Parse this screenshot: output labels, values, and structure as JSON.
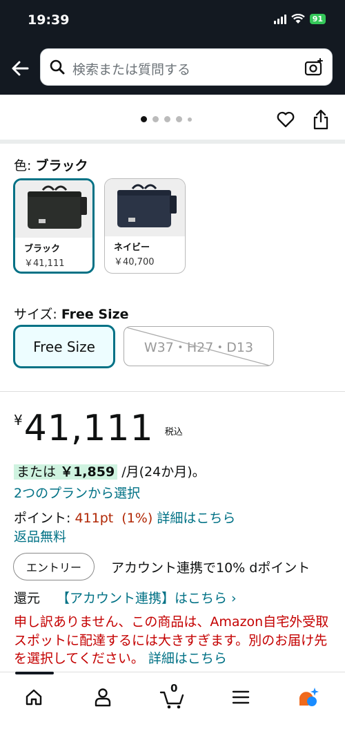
{
  "status": {
    "time": "19:39",
    "battery": "91"
  },
  "search": {
    "placeholder": "検索または質問する"
  },
  "carousel": {
    "dots": 5,
    "active": 0
  },
  "color": {
    "label": "色: ",
    "selected": "ブラック",
    "options": [
      {
        "name": "ブラック",
        "price": "￥41,111",
        "selected": true
      },
      {
        "name": "ネイビー",
        "price": "￥40,700",
        "selected": false
      }
    ]
  },
  "size": {
    "label": "サイズ: ",
    "selected": "Free Size",
    "options": [
      {
        "name": "Free Size",
        "selected": true,
        "available": true
      },
      {
        "name": "W37・H27・D13",
        "selected": false,
        "available": false
      }
    ]
  },
  "price": {
    "currency": "¥",
    "amount": "41,111",
    "tax": "税込"
  },
  "installment": {
    "prefix": "または",
    "amount": "￥1,859",
    "suffix": " /月(24か月)。",
    "plans_link": "2つのプランから選択"
  },
  "points": {
    "label": "ポイント: ",
    "value": "411pt  (1%)",
    "link": "詳細はこちら"
  },
  "returns": "返品無料",
  "entry": {
    "button": "エントリー",
    "text": "アカウント連携で10% dポイント"
  },
  "cashback": {
    "label": "還元",
    "link": "【アカウント連携】はこちら ›"
  },
  "warning": {
    "text": "申し訳ありません、この商品は、Amazon自宅外受取スポットに配達するには大きすぎます。別のお届け先を選択してください。 ",
    "link": "詳細はこちら"
  },
  "cart": {
    "count": "0"
  },
  "colors": {
    "header": "#131921",
    "accent": "#007185",
    "price_red": "#b12704",
    "warning": "#c40000",
    "highlight": "#cff3e0"
  }
}
